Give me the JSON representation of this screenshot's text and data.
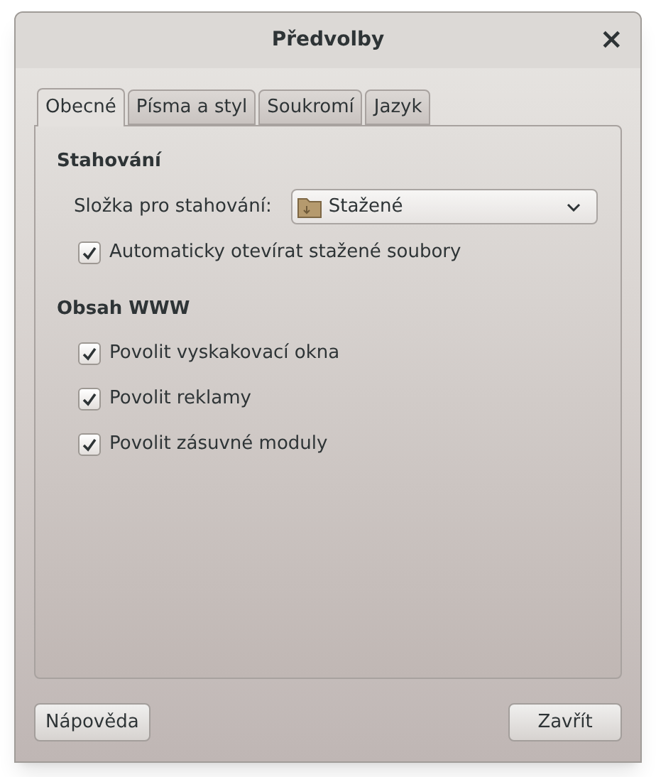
{
  "window": {
    "title": "Předvolby",
    "close": "×"
  },
  "tabs": [
    {
      "label": "Obecné",
      "selected": true
    },
    {
      "label": "Písma a styl",
      "selected": false
    },
    {
      "label": "Soukromí",
      "selected": false
    },
    {
      "label": "Jazyk",
      "selected": false
    }
  ],
  "sections": [
    {
      "heading": "Stahování",
      "items": [
        {
          "kind": "dropdown",
          "label": "Složka pro stahování:",
          "value": "Stažené"
        },
        {
          "kind": "checkbox",
          "label": "Automaticky otevírat stažené soubory",
          "checked": true
        }
      ]
    },
    {
      "heading": "Obsah WWW",
      "items": [
        {
          "kind": "checkbox",
          "label": "Povolit vyskakovací okna",
          "checked": true
        },
        {
          "kind": "checkbox",
          "label": "Povolit reklamy",
          "checked": true
        },
        {
          "kind": "checkbox",
          "label": "Povolit zásuvné moduly",
          "checked": true
        }
      ]
    }
  ],
  "buttons": [
    "Nápověda",
    "Zavřít"
  ]
}
